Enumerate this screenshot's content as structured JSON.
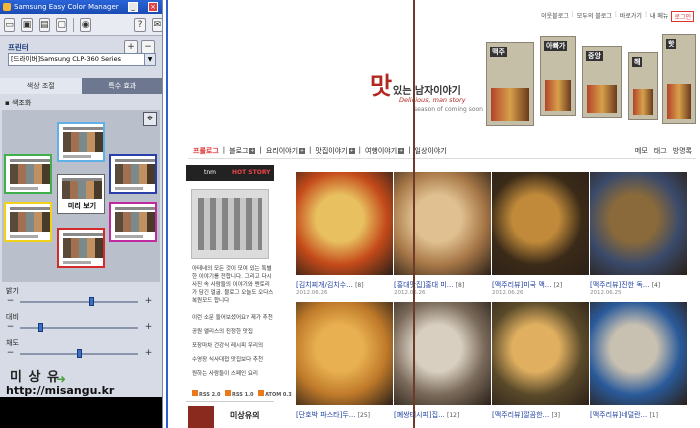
{
  "ecm": {
    "title": "Samsung Easy Color Manager",
    "printer_label": "프린터",
    "printer_value": "[드라이버]Samsung CLP-360 Series",
    "tabs": [
      "색상 조절",
      "특수 효과"
    ],
    "section_label": "▪ 색조화",
    "center_caption": "미리 보기",
    "sliders": [
      {
        "label": "밝기",
        "value": 0.6
      },
      {
        "label": "대비",
        "value": 0.17
      },
      {
        "label": "채도",
        "value": 0.5
      }
    ],
    "watermark_name": "미 상 유",
    "watermark_url": "http://misangu.kr",
    "thumb_colors": [
      "#5fb0e6",
      "#3fb04a",
      "#2a3fa8",
      "#f0d21a",
      "#c02aa0",
      "#d42a2a"
    ]
  },
  "blog": {
    "topnav": [
      "이웃블로그",
      "모두의 블로그",
      "바로가기",
      "내 메뉴",
      "로그인"
    ],
    "logo_mat": "맛",
    "logo_text": "있는 남자이야기",
    "logo_sub": "Delicious, man story",
    "logo_sub2": "season of coming soon",
    "banners": [
      "맥주",
      "아빠가",
      "중앙",
      "해",
      "핫"
    ],
    "menu": [
      "프롤로그",
      "블로그",
      "요리이야기",
      "맛집이야기",
      "여행이야기",
      "일상이야기"
    ],
    "right_menu": [
      "메모",
      "태그",
      "방명록"
    ],
    "hot_logo": "tnm",
    "hot_label": "HOT STORY",
    "hot_caption": "아테네의 모든 것이 모여 있는 특별한 이야기를 전합니다. 그리고 다시 사진 속 사람들의 이야기와 멘토리가 담긴 얼굴. 블로그 오늘도 오다스 복원모드 합니다",
    "sb_lines": [
      "이런 소문 들어보셨어요? 제가 추천",
      "공원 앨리스의 진정한 맛집",
      "포장마차 건강식 레시피 우리의",
      "수영장 식사대접 맛집보다 추천",
      "원하는 사람들이 스페인 요리"
    ],
    "rss": [
      "RSS 2.0",
      "RSS 1.0",
      "ATOM 0.3"
    ],
    "misangu": "미상유의",
    "posts": [
      {
        "title": "[김치찌개/김치수...",
        "count": "[8]",
        "date": "2012.06.26",
        "c1": "#c44a1a",
        "c2": "#e8c060"
      },
      {
        "title": "[홍대맛집]홍대 미...",
        "count": "[8]",
        "date": "2012.06.26",
        "c1": "#a87848",
        "c2": "#e0c090"
      },
      {
        "title": "[맥주리뷰]미국 맥...",
        "count": "[2]",
        "date": "2012.06.26",
        "c1": "#3a2a18",
        "c2": "#c08a3a"
      },
      {
        "title": "[맥주리뷰]진한 독...",
        "count": "[4]",
        "date": "2012.06.25",
        "c1": "#3a4a6a",
        "c2": "#8a6a3a"
      },
      {
        "title": "[단호박 파스타]두...",
        "count": "[25]",
        "date": "",
        "c1": "#c07a2a",
        "c2": "#e8b050"
      },
      {
        "title": "[폐쌍테시피]집...",
        "count": "[12]",
        "date": "",
        "c1": "#7a6a5a",
        "c2": "#d8cfc0"
      },
      {
        "title": "[맥주리뷰]깔끔한...",
        "count": "[3]",
        "date": "",
        "c1": "#5a4a2a",
        "c2": "#e0b060"
      },
      {
        "title": "[맥주리뷰]네덜란...",
        "count": "[1]",
        "date": "",
        "c1": "#2a5a9a",
        "c2": "#c8c0b0"
      }
    ]
  }
}
